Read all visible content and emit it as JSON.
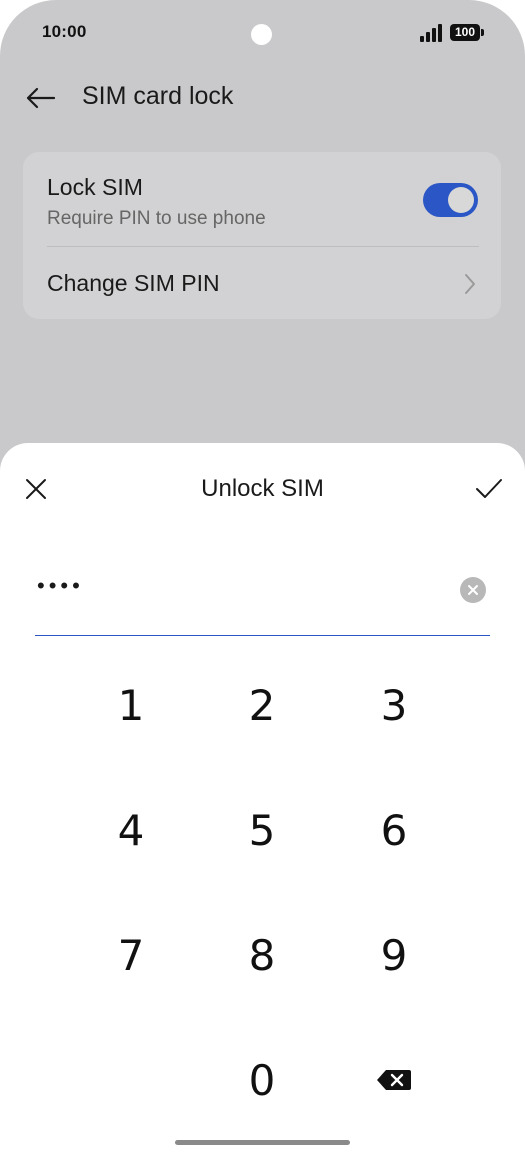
{
  "status_bar": {
    "time": "10:00",
    "battery": "100",
    "icons": [
      "signal-icon",
      "battery-icon"
    ]
  },
  "header": {
    "title": "SIM card lock",
    "back_icon": "arrow-left-icon"
  },
  "settings": {
    "lock_sim": {
      "title": "Lock SIM",
      "subtitle": "Require PIN to use phone",
      "enabled": true
    },
    "change_pin": {
      "title": "Change SIM PIN",
      "icon": "chevron-right-icon"
    }
  },
  "dialog": {
    "title": "Unlock SIM",
    "close_icon": "close-icon",
    "confirm_icon": "check-icon",
    "pin_display": "••••",
    "clear_icon": "clear-circle-icon"
  },
  "keypad": {
    "keys": [
      "1",
      "2",
      "3",
      "4",
      "5",
      "6",
      "7",
      "8",
      "9",
      "0"
    ],
    "backspace_icon": "backspace-icon"
  },
  "colors": {
    "accent": "#2a56c6",
    "scrim_background": "#c9c9cb",
    "card_background": "#d2d2d4",
    "sheet_background": "#ffffff"
  }
}
